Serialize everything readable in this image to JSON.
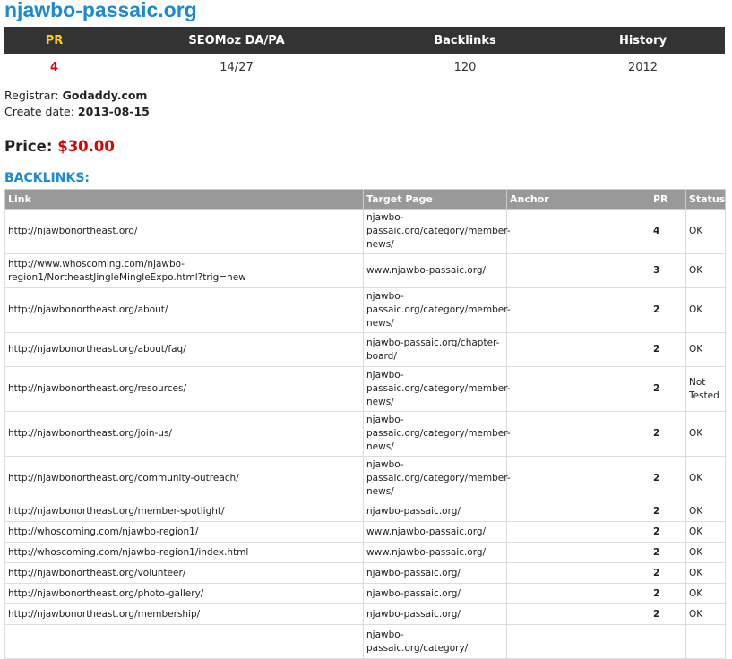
{
  "site": {
    "title": "njawbo-passaic.org"
  },
  "stats": {
    "headers": {
      "pr": "PR",
      "seomoz": "SEOMoz DA/PA",
      "backlinks": "Backlinks",
      "history": "History"
    },
    "values": {
      "pr": "4",
      "seomoz": "14/27",
      "backlinks": "120",
      "history": "2012"
    }
  },
  "info": {
    "registrar_label": "Registrar:",
    "registrar": "Godaddy.com",
    "create_label": "Create date:",
    "create_date": "2013-08-15"
  },
  "price": {
    "label": "Price:",
    "value": "$30.00"
  },
  "backlinks": {
    "title": "BACKLINKS:",
    "headers": {
      "link": "Link",
      "target": "Target Page",
      "anchor": "Anchor",
      "pr": "PR",
      "status": "Status"
    },
    "rows": [
      {
        "link": "http://njawbonortheast.org/",
        "target": "njawbo-passaic.org/category/member-news/",
        "anchor": "",
        "pr": "4",
        "status": "OK"
      },
      {
        "link": "http://www.whoscoming.com/njawbo-region1/NortheastJingleMingleExpo.html?trig=new",
        "target": "www.njawbo-passaic.org/",
        "anchor": "",
        "pr": "3",
        "status": "OK"
      },
      {
        "link": "http://njawbonortheast.org/about/",
        "target": "njawbo-passaic.org/category/member-news/",
        "anchor": "",
        "pr": "2",
        "status": "OK"
      },
      {
        "link": "http://njawbonortheast.org/about/faq/",
        "target": "njawbo-passaic.org/chapter-board/",
        "anchor": "",
        "pr": "2",
        "status": "OK"
      },
      {
        "link": "http://njawbonortheast.org/resources/",
        "target": "njawbo-passaic.org/category/member-news/",
        "anchor": "",
        "pr": "2",
        "status": "Not Tested"
      },
      {
        "link": "http://njawbonortheast.org/join-us/",
        "target": "njawbo-passaic.org/category/member-news/",
        "anchor": "",
        "pr": "2",
        "status": "OK"
      },
      {
        "link": "http://njawbonortheast.org/community-outreach/",
        "target": "njawbo-passaic.org/category/member-news/",
        "anchor": "",
        "pr": "2",
        "status": "OK"
      },
      {
        "link": "http://njawbonortheast.org/member-spotlight/",
        "target": "njawbo-passaic.org/",
        "anchor": "",
        "pr": "2",
        "status": "OK"
      },
      {
        "link": "http://whoscoming.com/njawbo-region1/",
        "target": "www.njawbo-passaic.org/",
        "anchor": "",
        "pr": "2",
        "status": "OK"
      },
      {
        "link": "http://whoscoming.com/njawbo-region1/index.html",
        "target": "www.njawbo-passaic.org/",
        "anchor": "",
        "pr": "2",
        "status": "OK"
      },
      {
        "link": "http://njawbonortheast.org/volunteer/",
        "target": "njawbo-passaic.org/",
        "anchor": "",
        "pr": "2",
        "status": "OK"
      },
      {
        "link": "http://njawbonortheast.org/photo-gallery/",
        "target": "njawbo-passaic.org/",
        "anchor": "",
        "pr": "2",
        "status": "OK"
      },
      {
        "link": "http://njawbonortheast.org/membership/",
        "target": "njawbo-passaic.org/",
        "anchor": "",
        "pr": "2",
        "status": "OK"
      },
      {
        "link": "",
        "target": "njawbo-passaic.org/category/",
        "anchor": "",
        "pr": "",
        "status": ""
      }
    ]
  }
}
